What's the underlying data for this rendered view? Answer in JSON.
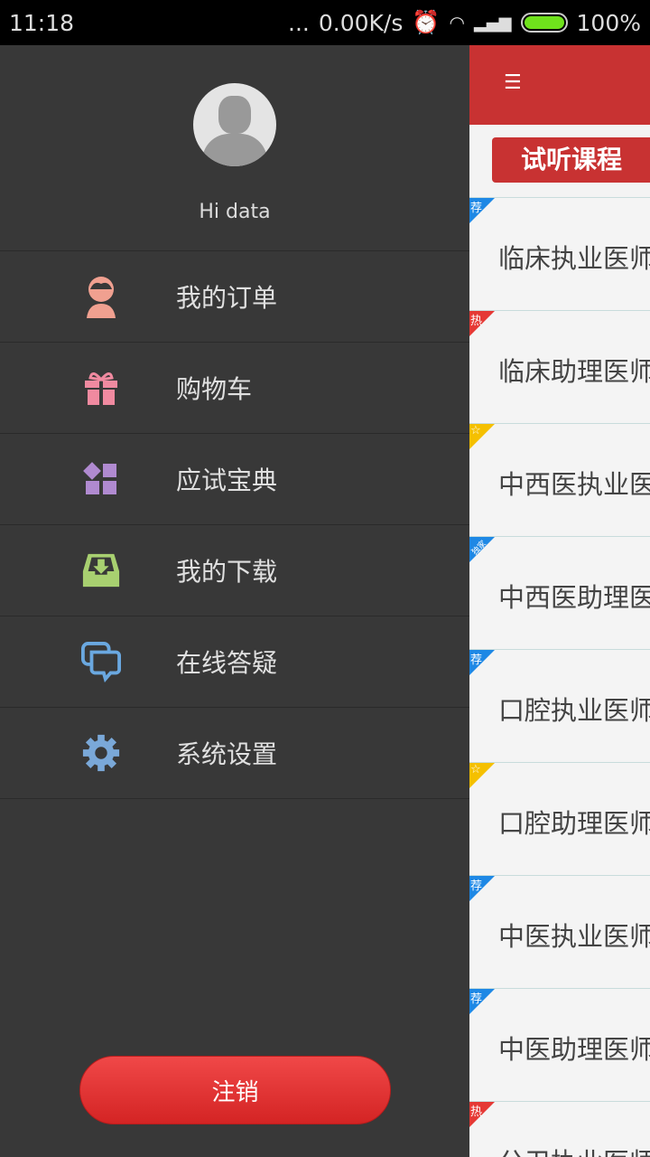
{
  "status_bar": {
    "time": "11:18",
    "dots": "...",
    "speed": "0.00K/s",
    "battery": "100%",
    "battery_color": "#6fe21c"
  },
  "drawer": {
    "greeting": "Hi data",
    "items": [
      {
        "label": "我的订单",
        "icon": "user-icon",
        "color": "#f0a090"
      },
      {
        "label": "购物车",
        "icon": "gift-icon",
        "color": "#f08aa0"
      },
      {
        "label": "应试宝典",
        "icon": "grid-icon",
        "color": "#b08ad0"
      },
      {
        "label": "我的下载",
        "icon": "download-tray-icon",
        "color": "#a8d070"
      },
      {
        "label": "在线答疑",
        "icon": "chat-icon",
        "color": "#6aa8e0"
      },
      {
        "label": "系统设置",
        "icon": "gear-icon",
        "color": "#7aa8d8"
      }
    ],
    "logout": "注销"
  },
  "main": {
    "accent": "#c83232",
    "trial_label": "试听课程",
    "courses": [
      {
        "name": "临床执业医师",
        "tag": "荐",
        "tag_color": "#1e88e5"
      },
      {
        "name": "临床助理医师",
        "tag": "热",
        "tag_color": "#e53935"
      },
      {
        "name": "中西医执业医师",
        "tag": "☆",
        "tag_color": "#f5c000"
      },
      {
        "name": "中西医助理医师",
        "tag": "独家",
        "tag_color": "#1e88e5"
      },
      {
        "name": "口腔执业医师",
        "tag": "荐",
        "tag_color": "#1e88e5"
      },
      {
        "name": "口腔助理医师",
        "tag": "☆",
        "tag_color": "#f5c000"
      },
      {
        "name": "中医执业医师",
        "tag": "荐",
        "tag_color": "#1e88e5"
      },
      {
        "name": "中医助理医师",
        "tag": "荐",
        "tag_color": "#1e88e5"
      },
      {
        "name": "公卫执业医师",
        "tag": "热",
        "tag_color": "#e53935"
      }
    ]
  }
}
